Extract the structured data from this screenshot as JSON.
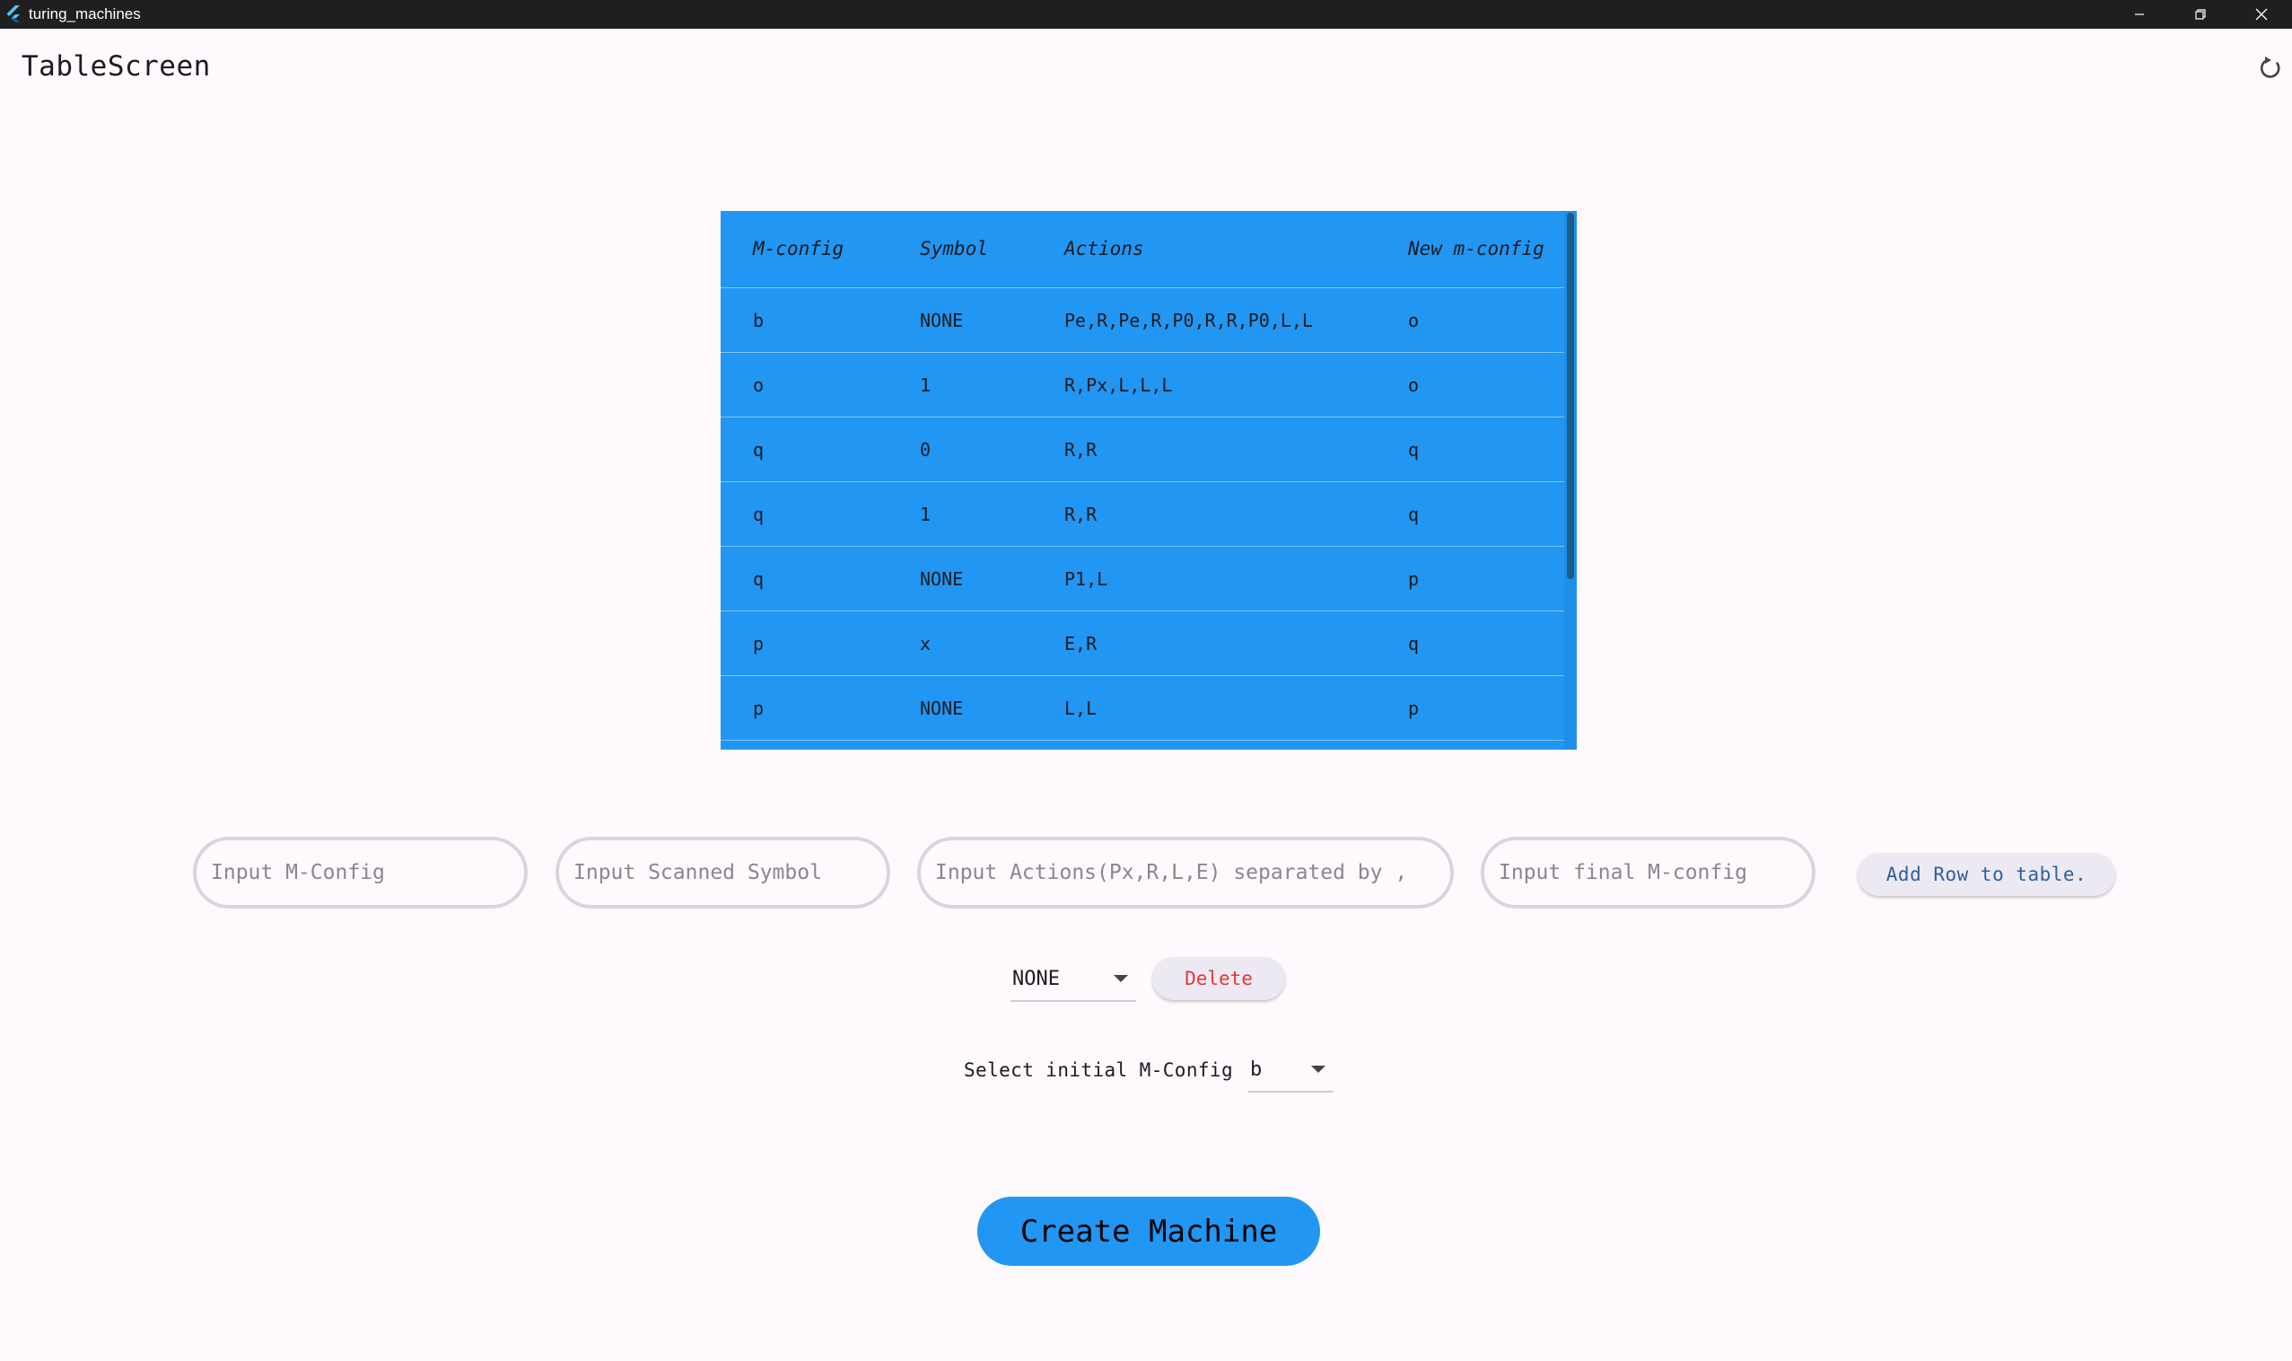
{
  "window": {
    "title": "turing_machines"
  },
  "app_bar": {
    "title": "TableScreen",
    "refresh_icon": "refresh-icon"
  },
  "table": {
    "headers": [
      "M-config",
      "Symbol",
      "Actions",
      "New m-config"
    ],
    "rows": [
      [
        "b",
        "NONE",
        "Pe,R,Pe,R,P0,R,R,P0,L,L",
        "o"
      ],
      [
        "o",
        "1",
        "R,Px,L,L,L",
        "o"
      ],
      [
        "q",
        "0",
        "R,R",
        "q"
      ],
      [
        "q",
        "1",
        "R,R",
        "q"
      ],
      [
        "q",
        "NONE",
        "P1,L",
        "p"
      ],
      [
        "p",
        "x",
        "E,R",
        "q"
      ],
      [
        "p",
        "NONE",
        "L,L",
        "p"
      ]
    ],
    "background_color": "#2196f3"
  },
  "inputs": {
    "mconfig_placeholder": "Input M-Config",
    "symbol_placeholder": "Input Scanned Symbol",
    "actions_placeholder": "Input Actions(Px,R,L,E) separated by ,",
    "final_mconfig_placeholder": "Input final M-config",
    "add_row_label": "Add Row to table."
  },
  "delete_controls": {
    "selected": "NONE",
    "delete_label": "Delete",
    "delete_color": "#e53935"
  },
  "initial_config": {
    "label": "Select initial M-Config",
    "selected": "b"
  },
  "create_button": {
    "label": "Create Machine",
    "color": "#2196f3"
  }
}
